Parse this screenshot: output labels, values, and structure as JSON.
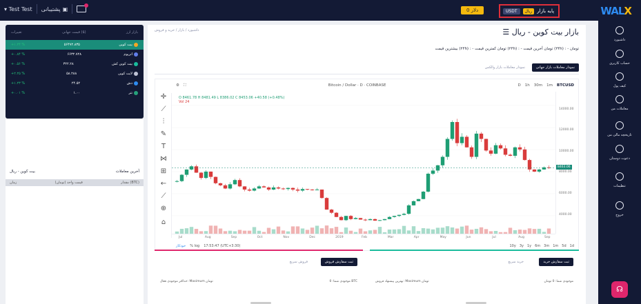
{
  "topbar": {
    "user": "Test Test",
    "wallet_label": "پشتیبانی",
    "price_pill": "0 دلار",
    "mode_label": "پایه بازار",
    "mode_selected": "ریال",
    "mode_other": "USDT",
    "logo_main": "WAL",
    "logo_accent": "X"
  },
  "nav": [
    {
      "label": "داشبورد",
      "icon": "dashboard-icon"
    },
    {
      "label": "حساب کاربری",
      "icon": "user-icon"
    },
    {
      "label": "کیف پول",
      "icon": "wallet-icon"
    },
    {
      "label": "معاملات من",
      "icon": "trades-icon"
    },
    {
      "label": "تاریخچه مالی من",
      "icon": "history-icon"
    },
    {
      "label": "دعوت دوستان",
      "icon": "invite-icon"
    },
    {
      "label": "تنظیمات",
      "icon": "settings-icon"
    },
    {
      "label": "خروج",
      "icon": "logout-icon"
    }
  ],
  "markets": {
    "headers": [
      "بازار ارز",
      "قیمت جهانی ($)",
      "تغییرات"
    ],
    "rows": [
      {
        "name": "بیت کوین",
        "price": "۵۶۴۷۲.۸۳۵",
        "change": "+۱.۲۴ %",
        "color": "#f5a623",
        "active": true
      },
      {
        "name": "اتریوم",
        "price": "۶۶۳۲.۷۲۸",
        "change": "+۰.۸۴ %",
        "color": "#627eea",
        "active": false
      },
      {
        "name": "بیت کوین کش",
        "price": "۳۲۲.۲۸",
        "change": "+۰.۵۶ %",
        "color": "#1abc9c",
        "active": false
      },
      {
        "name": "لایت کوین",
        "price": "۵۸.۲۸۸",
        "change": "+۲.۲۵ %",
        "color": "#c0c4d6",
        "active": false
      },
      {
        "name": "دش",
        "price": "۲۴.۵۲",
        "change": "+۱.۲۳ %",
        "color": "#2e8bf0",
        "active": false
      },
      {
        "name": "تتر",
        "price": "۱.۰۰",
        "change": "+۰.۰۱ %",
        "color": "#26a17b",
        "active": false
      }
    ]
  },
  "trades": {
    "title": "آخرین معاملات",
    "pair": "بیت کوین - ریال",
    "headers": [
      "مقدار (BTC)",
      "قیمت واحد (تومان)",
      "زمان"
    ]
  },
  "main": {
    "breadcrumb": "داشبورد  /  بازار  /  خرید و فروش",
    "title": "بازار بیت کوین - ریال",
    "stats": "بیشترین قیمت (۲۴h) : - تومان    کمترین قیمت (۲۴h) : - تومان    آخرین قیمت (۲۴h) : - تومان",
    "tab_active": "نمودار معاملات بازار جهانی",
    "tab_other": "نمودار معاملات بازار والکس"
  },
  "chart_toolbar": {
    "symbol": "BTCUSD",
    "intervals": [
      "1m",
      "30m",
      "1h",
      "D"
    ],
    "pair_text": "Bitcoin / Dollar · D · COINBASE",
    "ohlc": "O 8461.78  H 8481.49  L 8386.02  C 8453.06  +40.58 (+0.48%)",
    "volume": "Vol 24"
  },
  "chart_data": {
    "type": "candlestick",
    "symbol": "BTCUSD",
    "x_ticks": [
      "Jul",
      "Aug",
      "Sep",
      "Oct",
      "Nov",
      "Dec",
      "2019",
      "Feb",
      "Mar",
      "Apr",
      "May",
      "Jun",
      "Jul",
      "Aug",
      "Sep"
    ],
    "y_ticks": [
      "14000.00",
      "12000.00",
      "10000.00",
      "8000.00",
      "6000.00",
      "4000.00"
    ],
    "last_price": "8463.06",
    "values": [
      7200,
      7800,
      8300,
      8600,
      8000,
      7500,
      8100,
      7600,
      7000,
      6800,
      6500,
      6900,
      7300,
      6700,
      6400,
      6300,
      6500,
      6700,
      6600,
      6400,
      6600,
      6500,
      6450,
      6550,
      6400,
      6300,
      6450,
      6400,
      6380,
      6400,
      5600,
      4500,
      4200,
      3800,
      3500,
      3900,
      3600,
      3700,
      3550,
      3500,
      3600,
      3450,
      3500,
      3600,
      3800,
      3900,
      4000,
      4100,
      4900,
      5300,
      5500,
      6200,
      7900,
      8200,
      8700,
      9500,
      11200,
      12800,
      10800,
      11400,
      10400,
      9500,
      11700,
      11200,
      10100,
      9800,
      10600,
      10300,
      9700,
      9600,
      10400,
      10200,
      9200,
      8300,
      8100,
      8300,
      8500,
      8463
    ]
  },
  "chart_footer": {
    "ranges": [
      "10y",
      "3y",
      "1y",
      "6m",
      "3m",
      "1m",
      "5d",
      "1d"
    ],
    "time": "17:53:47 (UTC+3:30)",
    "scale": "% log",
    "auto": "خودکار"
  },
  "order_sell": {
    "tab_active": "ثبت سفارش فروش",
    "tab_other": "فروش سریع",
    "balance": "موجودی شما: 0 BTC",
    "max": "حداکثر موجودی فعال: Maximum تومان"
  },
  "order_buy": {
    "tab_active": "ثبت سفارش خرید",
    "tab_other": "خرید سریع",
    "balance": "موجودی شما: 0 تومان",
    "max": "بهترین پیشنهاد فروش: Maximum تومان"
  }
}
